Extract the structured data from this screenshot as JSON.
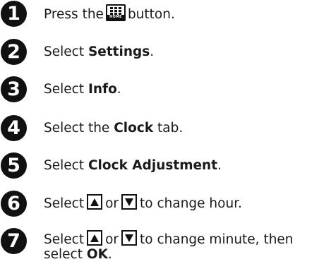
{
  "steps": [
    {
      "number": "1",
      "before": "Press the",
      "icon_label": "HOME",
      "icon": "home-button-icon",
      "after": "button."
    },
    {
      "number": "2",
      "before": "Select",
      "bold": "Settings",
      "after": "."
    },
    {
      "number": "3",
      "before": "Select",
      "bold": "Info",
      "after": "."
    },
    {
      "number": "4",
      "before": "Select the",
      "bold": "Clock",
      "after": "tab."
    },
    {
      "number": "5",
      "before": "Select",
      "bold": "Clock Adjustment",
      "after": "."
    },
    {
      "number": "6",
      "before": "Select",
      "middle": "or",
      "after": "to change hour.",
      "icons": [
        "up-arrow-icon",
        "down-arrow-icon"
      ]
    },
    {
      "number": "7",
      "before": "Select",
      "middle": "or",
      "after": "to change minute, then",
      "line2_before": "select",
      "line2_bold": "OK",
      "line2_after": ".",
      "icons": [
        "up-arrow-icon",
        "down-arrow-icon"
      ]
    }
  ]
}
